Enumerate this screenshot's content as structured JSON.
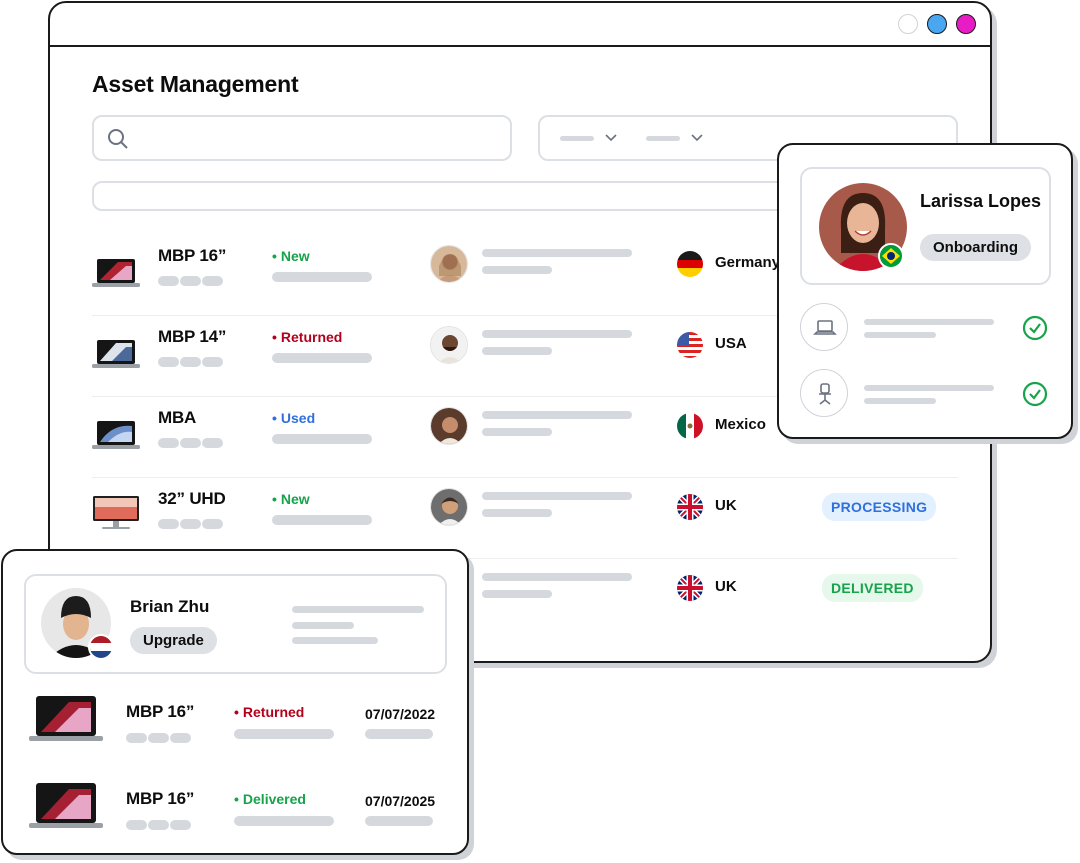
{
  "window": {
    "title": "Asset Management",
    "traffic_colors": [
      "#ffffff",
      "#49a7f2",
      "#e81cc4"
    ]
  },
  "search": {
    "placeholder": ""
  },
  "assets": [
    {
      "name": "MBP 16”",
      "device": "laptop-icon",
      "status": "New",
      "status_color": "#16a34a",
      "country": "Germany",
      "flag": "germany-flag-icon",
      "badge": ""
    },
    {
      "name": "MBP 14”",
      "device": "laptop-icon",
      "status": "Returned",
      "status_color": "#b3001b",
      "country": "USA",
      "flag": "usa-flag-icon",
      "badge": ""
    },
    {
      "name": "MBA",
      "device": "laptop-icon",
      "status": "Used",
      "status_color": "#2f6fde",
      "country": "Mexico",
      "flag": "mexico-flag-icon",
      "badge": ""
    },
    {
      "name": "32” UHD",
      "device": "monitor-icon",
      "status": "New",
      "status_color": "#16a34a",
      "country": "UK",
      "flag": "uk-flag-icon",
      "badge": "PROCESSING",
      "badge_color": "#2f6fde",
      "badge_bg": "#e3f0fd"
    },
    {
      "name": "",
      "device": "",
      "status": "",
      "country": "UK",
      "flag": "uk-flag-icon",
      "badge": "DELIVERED",
      "badge_color": "#16a34a",
      "badge_bg": "#e6f7ec"
    }
  ],
  "profile_card": {
    "name": "Larissa Lopes",
    "tag": "Onboarding",
    "flag": "brazil-flag-icon",
    "items": [
      {
        "icon": "laptop-icon",
        "done": true
      },
      {
        "icon": "office-chair-icon",
        "done": true
      }
    ]
  },
  "user_card": {
    "name": "Brian Zhu",
    "tag": "Upgrade",
    "flag": "netherlands-flag-icon",
    "devices": [
      {
        "name": "MBP 16”",
        "status": "Returned",
        "status_color": "#b3001b",
        "date": "07/07/2022"
      },
      {
        "name": "MBP 16”",
        "status": "Delivered",
        "status_color": "#16a34a",
        "date": "07/07/2025"
      }
    ]
  }
}
